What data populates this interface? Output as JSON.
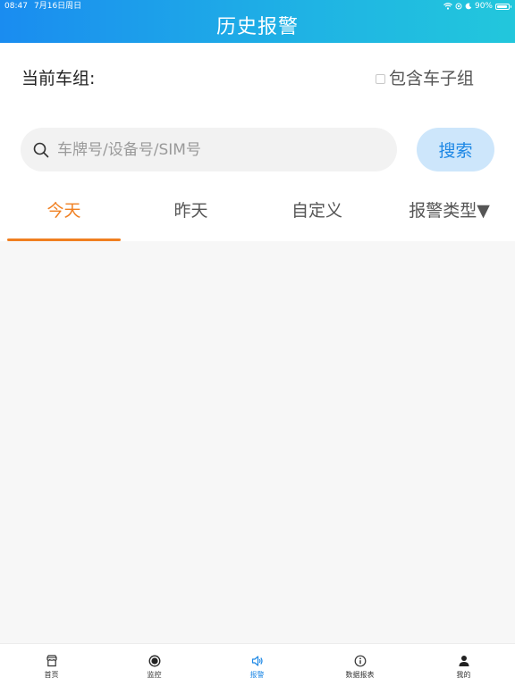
{
  "status_bar": {
    "time": "08:47",
    "date": "7月16日周日",
    "battery": "90%",
    "battery_level": 0.9
  },
  "header": {
    "title": "历史报警"
  },
  "group": {
    "label": "当前车组:",
    "include_subgroup_label": "包含车子组",
    "include_subgroup_checked": false
  },
  "search": {
    "placeholder": "车牌号/设备号/SIM号",
    "value": "",
    "button_label": "搜索"
  },
  "tabs": [
    {
      "label": "今天",
      "active": true
    },
    {
      "label": "昨天",
      "active": false
    },
    {
      "label": "自定义",
      "active": false
    },
    {
      "label": "报警类型▼",
      "active": false
    }
  ],
  "bottom_nav": [
    {
      "label": "首页",
      "icon": "home-icon",
      "active": false
    },
    {
      "label": "监控",
      "icon": "monitor-icon",
      "active": false
    },
    {
      "label": "报警",
      "icon": "speaker-icon",
      "active": true
    },
    {
      "label": "数据报表",
      "icon": "info-icon",
      "active": false
    },
    {
      "label": "我的",
      "icon": "user-icon",
      "active": false
    }
  ],
  "colors": {
    "header_start": "#1a8cf0",
    "header_end": "#22c7dc",
    "accent": "#f07f20",
    "primary": "#1e88e5"
  }
}
